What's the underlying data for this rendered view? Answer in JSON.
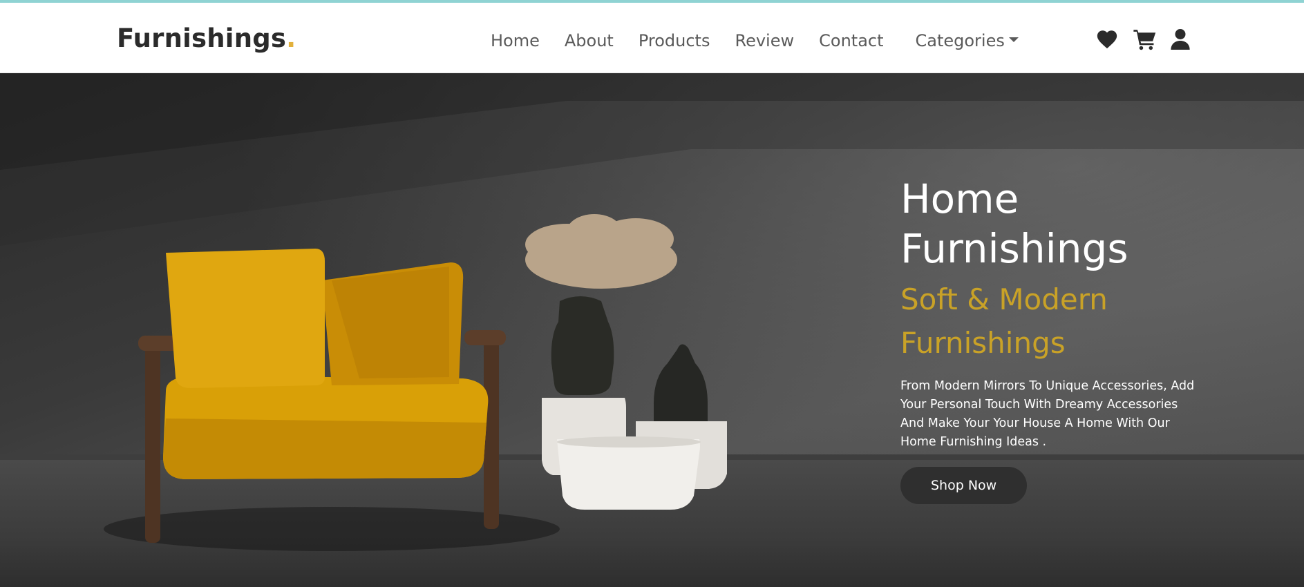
{
  "brand": {
    "name": "Furnishings",
    "dot": "."
  },
  "nav": {
    "links": [
      "Home",
      "About",
      "Products",
      "Review",
      "Contact"
    ],
    "dropdown_label": "Categories"
  },
  "icons": [
    "heart-icon",
    "cart-icon",
    "user-icon"
  ],
  "hero": {
    "title_line1": "Home",
    "title_line2": "Furnishings",
    "subtitle_line1": "Soft & Modern",
    "subtitle_line2": "Furnishings",
    "description": "From Modern Mirrors To Unique Accessories, Add Your Personal Touch With Dreamy Accessories And Make Your Your House A Home With Our Home Furnishing Ideas .",
    "cta_label": "Shop Now"
  },
  "colors": {
    "accent": "#c9a227",
    "brand_dot": "#e2b13c",
    "button_bg": "#2f2f2f",
    "nav_text": "#5a5a5a"
  }
}
